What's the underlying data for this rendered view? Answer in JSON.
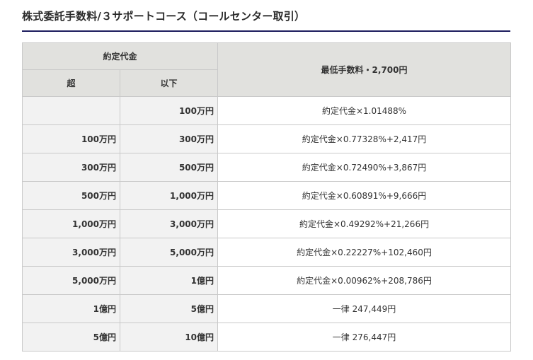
{
  "page": {
    "title": "株式委託手数料/３サポートコース（コールセンター取引）"
  },
  "table": {
    "header": {
      "contract_amount": "約定代金",
      "over": "超",
      "under": "以下",
      "minimum_fee": "最低手数料・2,700円"
    },
    "rows": [
      {
        "over": "",
        "under": "100万円",
        "fee": "約定代金×1.01488%"
      },
      {
        "over": "100万円",
        "under": "300万円",
        "fee": "約定代金×0.77328%+2,417円"
      },
      {
        "over": "300万円",
        "under": "500万円",
        "fee": "約定代金×0.72490%+3,867円"
      },
      {
        "over": "500万円",
        "under": "1,000万円",
        "fee": "約定代金×0.60891%+9,666円"
      },
      {
        "over": "1,000万円",
        "under": "3,000万円",
        "fee": "約定代金×0.49292%+21,266円"
      },
      {
        "over": "3,000万円",
        "under": "5,000万円",
        "fee": "約定代金×0.22227%+102,460円"
      },
      {
        "over": "5,000万円",
        "under": "1億円",
        "fee": "約定代金×0.00962%+208,786円"
      },
      {
        "over": "1億円",
        "under": "5億円",
        "fee": "一律 247,449円"
      },
      {
        "over": "5億円",
        "under": "10億円",
        "fee": "一律 276,447円"
      }
    ]
  }
}
